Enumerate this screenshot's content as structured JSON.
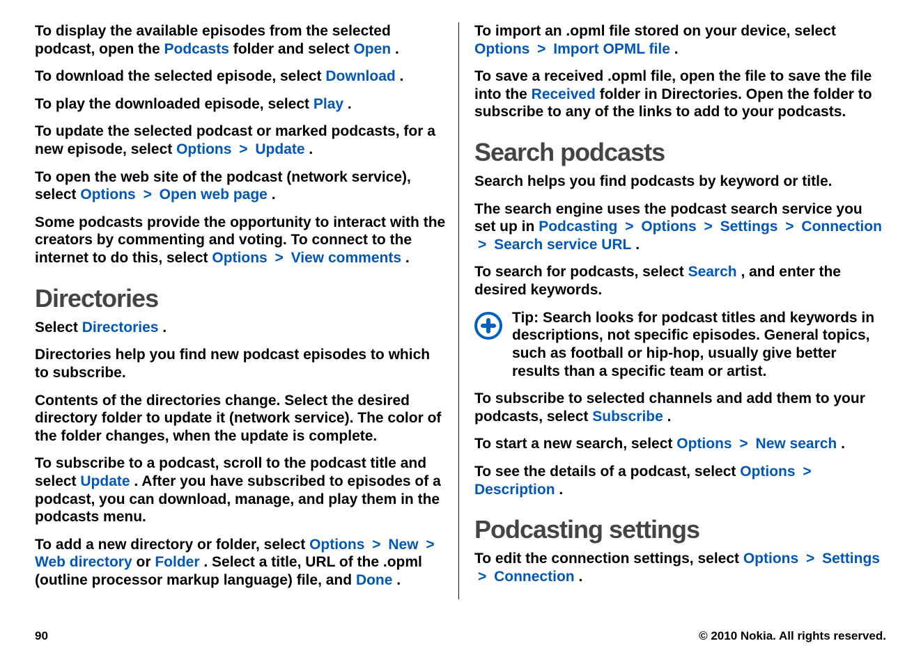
{
  "footer": {
    "page_number": "90",
    "copyright": "© 2010 Nokia. All rights reserved."
  },
  "left": {
    "p1_a": "To display the available episodes from the selected podcast, open the ",
    "p1_kw1": "Podcasts",
    "p1_b": " folder and select ",
    "p1_kw2": "Open",
    "p1_c": ".",
    "p2_a": "To download the selected episode, select ",
    "p2_kw1": "Download",
    "p2_b": ".",
    "p3_a": "To play the downloaded episode, select ",
    "p3_kw1": "Play",
    "p3_b": ".",
    "p4_a": "To update the selected podcast or marked podcasts, for a new episode, select ",
    "p4_kw1": "Options",
    "p4_sep1": ">",
    "p4_kw2": "Update",
    "p4_b": ".",
    "p5_a": "To open the web site of the podcast (network service), select ",
    "p5_kw1": "Options",
    "p5_sep1": ">",
    "p5_kw2": "Open web page",
    "p5_b": ".",
    "p6_a": "Some podcasts provide the opportunity to interact with the creators by commenting and voting. To connect to the internet to do this, select ",
    "p6_kw1": "Options",
    "p6_sep1": ">",
    "p6_kw2": "View comments",
    "p6_b": ".",
    "h_directories": "Directories",
    "p7_a": "Select ",
    "p7_kw1": "Directories",
    "p7_b": ".",
    "p8": "Directories help you find new podcast episodes to which to subscribe.",
    "p9": "Contents of the directories change. Select the desired directory folder to update it (network service). The color of the folder changes, when the update is complete.",
    "p10_a": "To subscribe to a podcast, scroll to the podcast title and select ",
    "p10_kw1": "Update",
    "p10_b": ". After you have subscribed to episodes of a podcast, you can download, manage, and play them in the podcasts menu.",
    "p11_a": "To add a new directory or folder, select ",
    "p11_kw1": "Options",
    "p11_sep1": ">",
    "p11_kw2": "New",
    "p11_sep2": ">",
    "p11_kw3": "Web directory",
    "p11_b": " or ",
    "p11_kw4": "Folder",
    "p11_c": ". Select a title, URL of the .opml (outline processor markup language) file, and",
    "p11_kw5": "Done",
    "p11_d": "."
  },
  "right": {
    "p1_a": "To import an .opml file stored on your device, select ",
    "p1_kw1": "Options",
    "p1_sep1": ">",
    "p1_kw2": "Import OPML file",
    "p1_b": ".",
    "p2_a": "To save a received .opml file, open the file to save the file into the ",
    "p2_kw1": "Received",
    "p2_b": " folder in Directories. Open the folder to subscribe to any of the links to add to your podcasts.",
    "h_search": "Search podcasts",
    "p3": "Search helps you find podcasts by keyword or title.",
    "p4_a": "The search engine uses the podcast search service you set up in ",
    "p4_kw1": "Podcasting",
    "p4_sep1": ">",
    "p4_kw2": "Options",
    "p4_sep2": ">",
    "p4_kw3": "Settings",
    "p4_sep3": ">",
    "p4_kw4": "Connection",
    "p4_sep4": ">",
    "p4_kw5": "Search service URL",
    "p4_b": ".",
    "p5_a": "To search for podcasts, select ",
    "p5_kw1": "Search",
    "p5_b": ", and enter the desired keywords.",
    "tip_label": "Tip:",
    "tip_text": " Search looks for podcast titles and keywords in descriptions, not specific episodes. General topics, such as football or hip-hop, usually give better results than a specific team or artist.",
    "p6_a": "To subscribe to selected channels and add them to your podcasts, select ",
    "p6_kw1": "Subscribe",
    "p6_b": ".",
    "p7_a": "To start a new search, select ",
    "p7_kw1": "Options",
    "p7_sep1": ">",
    "p7_kw2": "New search",
    "p7_b": ".",
    "p8_a": "To see the details of a podcast, select ",
    "p8_kw1": "Options",
    "p8_sep1": ">",
    "p8_kw2": "Description",
    "p8_b": ".",
    "h_settings": "Podcasting settings",
    "p9_a": "To edit the connection settings, select ",
    "p9_kw1": "Options",
    "p9_sep1": ">",
    "p9_kw2": "Settings",
    "p9_sep2": ">",
    "p9_kw3": "Connection",
    "p9_b": "."
  }
}
